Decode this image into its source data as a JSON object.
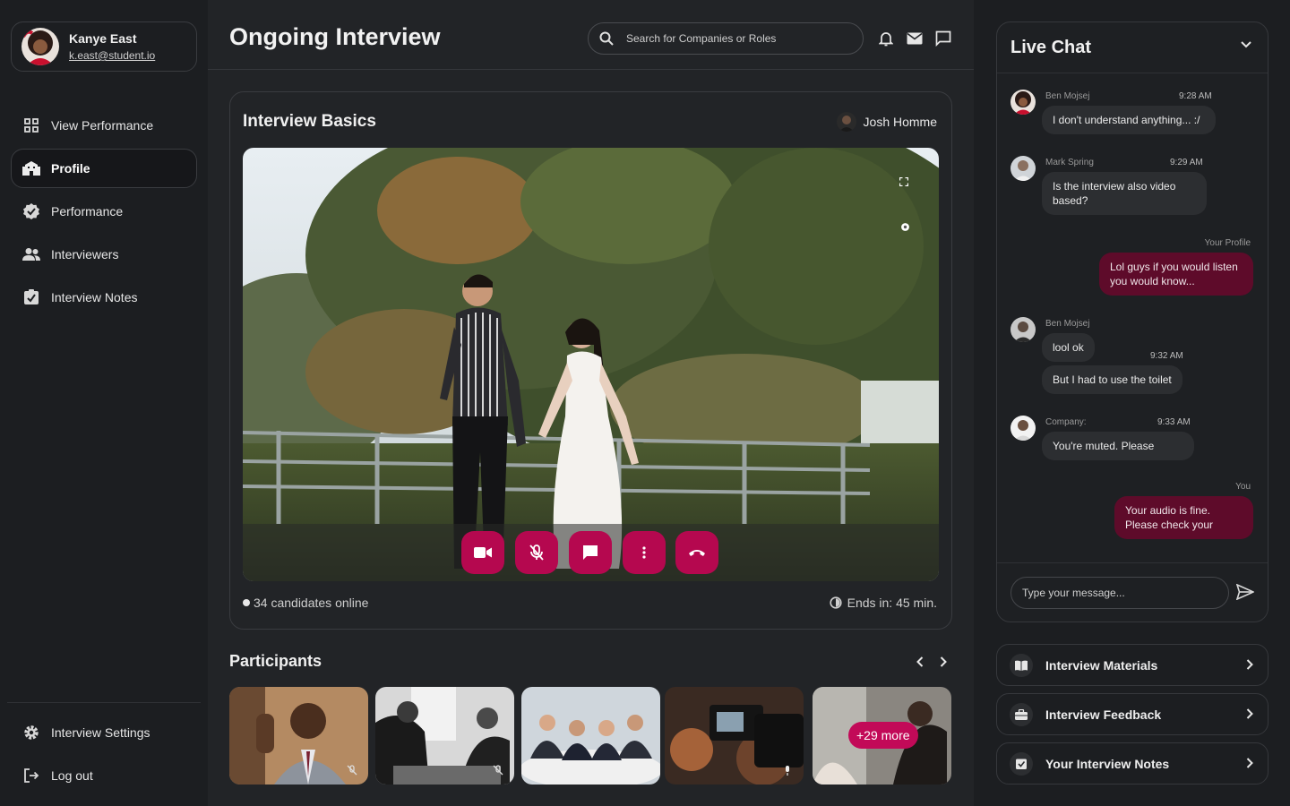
{
  "user": {
    "name": "Kanye East",
    "email": "k.east@student.io"
  },
  "nav": {
    "items": [
      {
        "label": "View Performance",
        "icon": "grid-icon"
      },
      {
        "label": "Profile",
        "icon": "building-icon"
      },
      {
        "label": "Performance",
        "icon": "verified-badge-icon"
      },
      {
        "label": "Interviewers",
        "icon": "people-icon"
      },
      {
        "label": "Interview Notes",
        "icon": "note-check-icon"
      }
    ],
    "active": "Profile",
    "bottom": [
      {
        "label": "Interview Settings",
        "icon": "gear-icon"
      },
      {
        "label": "Log out",
        "icon": "logout-icon"
      }
    ]
  },
  "header": {
    "title": "Ongoing Interview",
    "search_placeholder": "Search for Companies or Roles"
  },
  "interview": {
    "title": "Interview Basics",
    "host": "Josh Homme",
    "candidates_online": "34 candidates online",
    "ends_in": "Ends in: 45 min."
  },
  "participants": {
    "title": "Participants",
    "more_label": "+29 more"
  },
  "chat": {
    "title": "Live Chat",
    "messages": [
      {
        "name": "Ben Mojsej",
        "time": "9:28 AM",
        "text": "I don't understand anything... :/"
      },
      {
        "name": "Mark Spring",
        "time": "9:29 AM",
        "text": "Is the interview also video based?"
      },
      {
        "name": "Your Profile",
        "text": "Lol guys if you would listen you would know..."
      },
      {
        "name": "Ben Mojsej",
        "time": "9:32 AM",
        "text": "lool ok",
        "text2": "But I had to use the toilet"
      },
      {
        "name": "Company:",
        "time": "9:33 AM",
        "text": "You're muted. Please"
      },
      {
        "name": "You",
        "text": "Your audio is fine. Please check your"
      }
    ],
    "input_placeholder": "Type your message..."
  },
  "links": [
    {
      "label": "Interview Materials",
      "icon": "book-icon"
    },
    {
      "label": "Interview Feedback",
      "icon": "briefcase-icon"
    },
    {
      "label": "Your Interview Notes",
      "icon": "note-check-icon"
    }
  ],
  "colors": {
    "accent": "#b5084f",
    "bubble_mine": "#5e0b2a",
    "background": "#202225"
  }
}
